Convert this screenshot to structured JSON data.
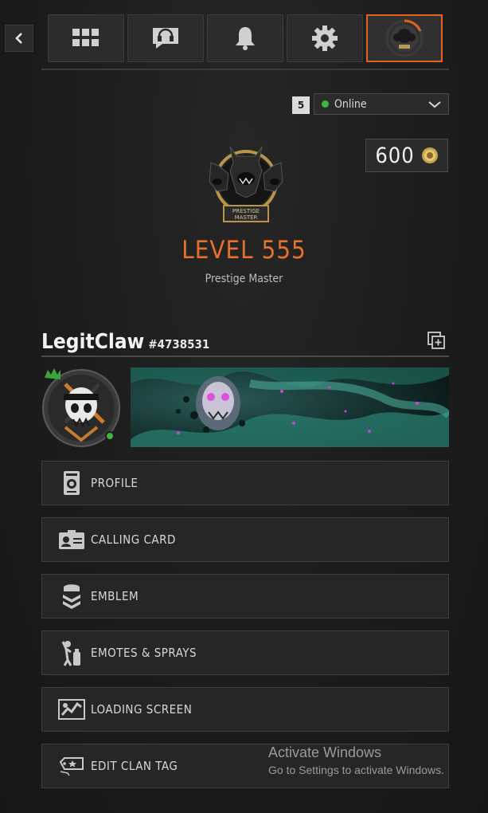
{
  "nav": {
    "back_icon": "chevron-left-icon",
    "tabs": [
      {
        "icon": "grid-icon"
      },
      {
        "icon": "headset-chat-icon"
      },
      {
        "icon": "bell-icon"
      },
      {
        "icon": "gear-icon"
      },
      {
        "icon": "prestige-avatar-icon",
        "active": true
      }
    ]
  },
  "status": {
    "party_count": "5",
    "selected": "Online",
    "dot_color": "#3fb53f"
  },
  "points": {
    "value": "600",
    "icon": "cod-points-icon"
  },
  "profile": {
    "emblem_text": "PRESTIGE MASTER",
    "level_label": "LEVEL 555",
    "level_sub": "Prestige Master",
    "gamertag": "LegitClaw",
    "gamer_id": "#4738531",
    "accent": "#e8702a"
  },
  "menu": [
    {
      "label": "PROFILE",
      "icon": "profile-card-icon"
    },
    {
      "label": "CALLING CARD",
      "icon": "calling-card-icon"
    },
    {
      "label": "EMBLEM",
      "icon": "emblem-icon"
    },
    {
      "label": "EMOTES & SPRAYS",
      "icon": "emotes-icon"
    },
    {
      "label": "LOADING SCREEN",
      "icon": "loading-screen-icon"
    },
    {
      "label": "EDIT CLAN TAG",
      "icon": "clan-tag-icon"
    }
  ],
  "watermark": {
    "title": "Activate Windows",
    "subtitle": "Go to Settings to activate Windows."
  }
}
